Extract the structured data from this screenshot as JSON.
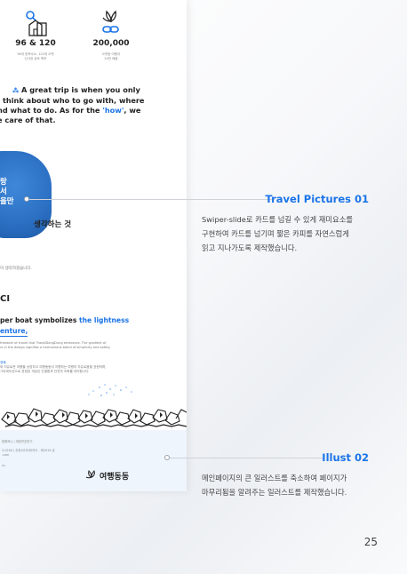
{
  "mock": {
    "stats": [
      {
        "icon": "search-building-icon",
        "value": "96 & 120",
        "caption_lines": [
          "96개 한옥숙소, 120개 오랫",
          "신사장 큐토 축하"
        ]
      },
      {
        "icon": "leaf-link-icon",
        "value": "200,000",
        "caption_lines": [
          "오랫동 여행자",
          "20만 배출"
        ]
      }
    ],
    "trip_lines": [
      "A great trip is when you only",
      "think about who to go with, where",
      "nd what to do. As for the ",
      "e care of that."
    ],
    "trip_how": "'how'",
    "trip_after_how": ", we",
    "blob_lines": [
      "랑",
      "서",
      "을만"
    ],
    "pictures_heading": "생각하는 것",
    "pictures_note": "이 생각하겠습니다.",
    "ci_heading": "CI",
    "paper_line1_plain": "per boat symbolizes ",
    "paper_line1_blue": "the lightness",
    "paper_line2_blue": "enture,",
    "small_en_lines": [
      "freedom of travel that TravelDangDung embraces. The gradient of",
      "rs in the design signifies a harmonious blend of simplicity and safety."
    ],
    "small_ko_blue": "경쾌",
    "small_ko_lines": [
      "와 자유로운 여행을 상징하고 여행동동이 지향하는 여행의 자유로움을 표현하며,",
      "그라데이션으로 표현된 색상은 간결함과 안전의 조화를 의미합니다."
    ],
    "footer_lines": [
      "탐원하니 | 대표번호번기",
      "3-0200 | 주문서디디비자녀 - 제2019-호",
      ".com",
      "nc."
    ],
    "logo_text": "여행동동"
  },
  "annotations": [
    {
      "title": "Travel Pictures  01",
      "desc_lines": [
        "Swiper-slide로 카드를 넘길 수 있게 재미요소를",
        "구현하여 카드를 넘기며 짧은 카피를 자연스럽게",
        "읽고 지나가도록 제작했습니다."
      ]
    },
    {
      "title": "Illust 02",
      "desc_lines": [
        "메인페이지의 큰 일러스트를 축소하여 페이지가",
        "마무리됨을 알려주는 일러스트를 제작했습니다."
      ]
    }
  ],
  "page_number": "25",
  "colors": {
    "accent": "#1a73e8",
    "ink": "#222222",
    "blob": "#2b6fc2",
    "footer_bg": "#eef5fd"
  }
}
